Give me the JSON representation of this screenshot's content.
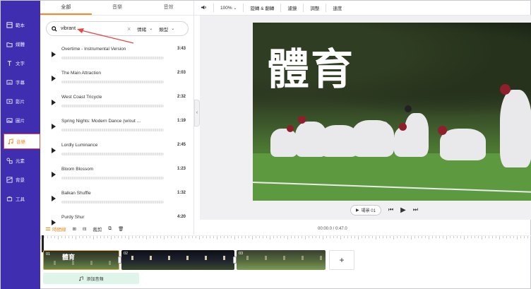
{
  "nav": {
    "items": [
      {
        "label": "範本",
        "icon": "template-icon"
      },
      {
        "label": "媒體",
        "icon": "media-icon"
      },
      {
        "label": "文字",
        "icon": "text-icon"
      },
      {
        "label": "字幕",
        "icon": "subtitle-icon"
      },
      {
        "label": "影片",
        "icon": "video-icon"
      },
      {
        "label": "圖片",
        "icon": "image-icon"
      },
      {
        "label": "音樂",
        "icon": "music-icon",
        "active": true
      },
      {
        "label": "元素",
        "icon": "elements-icon"
      },
      {
        "label": "背景",
        "icon": "background-icon"
      },
      {
        "label": "工具",
        "icon": "tools-icon"
      }
    ]
  },
  "library": {
    "tabs": [
      "全部",
      "音樂",
      "音效"
    ],
    "search": {
      "value": "vibrant",
      "mood_label": "情緒",
      "genre_label": "類型"
    },
    "tracks": [
      {
        "title": "Overtime - Instrumental Version",
        "duration": "3:43"
      },
      {
        "title": "The Main Attraction",
        "duration": "2:03"
      },
      {
        "title": "West Coast Tricycle",
        "duration": "2:32"
      },
      {
        "title": "Spring Nights: Modern Dance (w/out ...",
        "duration": "1:19"
      },
      {
        "title": "Lordly Luminance",
        "duration": "2:45"
      },
      {
        "title": "Bloom Blossom",
        "duration": "1:23"
      },
      {
        "title": "Balkan Shuffle",
        "duration": "1:32"
      },
      {
        "title": "Purdy Shur",
        "duration": "4:20"
      }
    ]
  },
  "toolbar": {
    "zoom": "100%",
    "items": [
      "旋轉 & 翻轉",
      "濾鏡",
      "調整",
      "速度"
    ]
  },
  "canvas": {
    "title_text": "體育",
    "scene_label": "場景 01"
  },
  "timeline": {
    "timeline_label": "時間線",
    "crop_label": "裁剪",
    "time": "00:00.0 / 0:47.0",
    "clips": [
      {
        "number": "01",
        "text": "體育"
      },
      {
        "number": "02",
        "text": ""
      },
      {
        "number": "03",
        "text": ""
      }
    ],
    "add_audio_label": "添加音頻"
  },
  "colors": {
    "nav_bg": "#3f2eb0",
    "accent": "#f28c2a",
    "annotation_red": "#e24a4a",
    "audio_track_bg": "#dff5ea"
  }
}
